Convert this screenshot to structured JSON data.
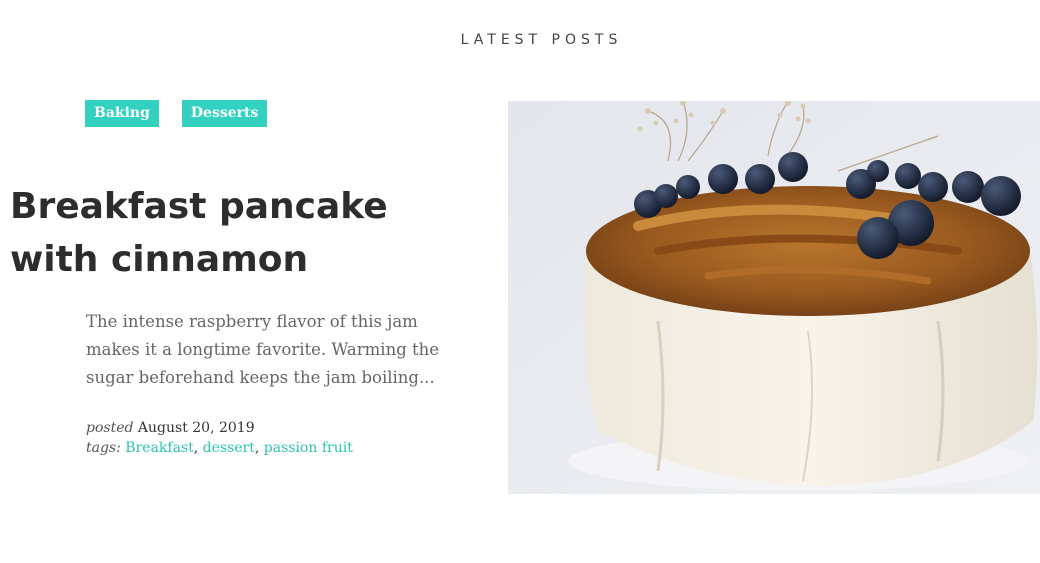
{
  "section": {
    "title": "LATEST POSTS"
  },
  "post": {
    "categories": [
      {
        "label": "Baking"
      },
      {
        "label": "Desserts"
      }
    ],
    "title": "Breakfast pancake with cinnamon",
    "excerpt": "The intense raspberry flavor of this jam makes it a longtime favorite. Warming the sugar beforehand keeps the jam boiling...",
    "posted_label": "posted",
    "posted_date": "August 20, 2019",
    "tags_label": "tags:",
    "tags": [
      {
        "label": "Breakfast"
      },
      {
        "label": "dessert"
      },
      {
        "label": "passion fruit"
      }
    ],
    "image_icon": "cake-with-blueberries-photo"
  },
  "colors": {
    "accent": "#33d1bf",
    "title": "#2d2d2d",
    "text": "#666666",
    "link": "#2cc3b3"
  }
}
